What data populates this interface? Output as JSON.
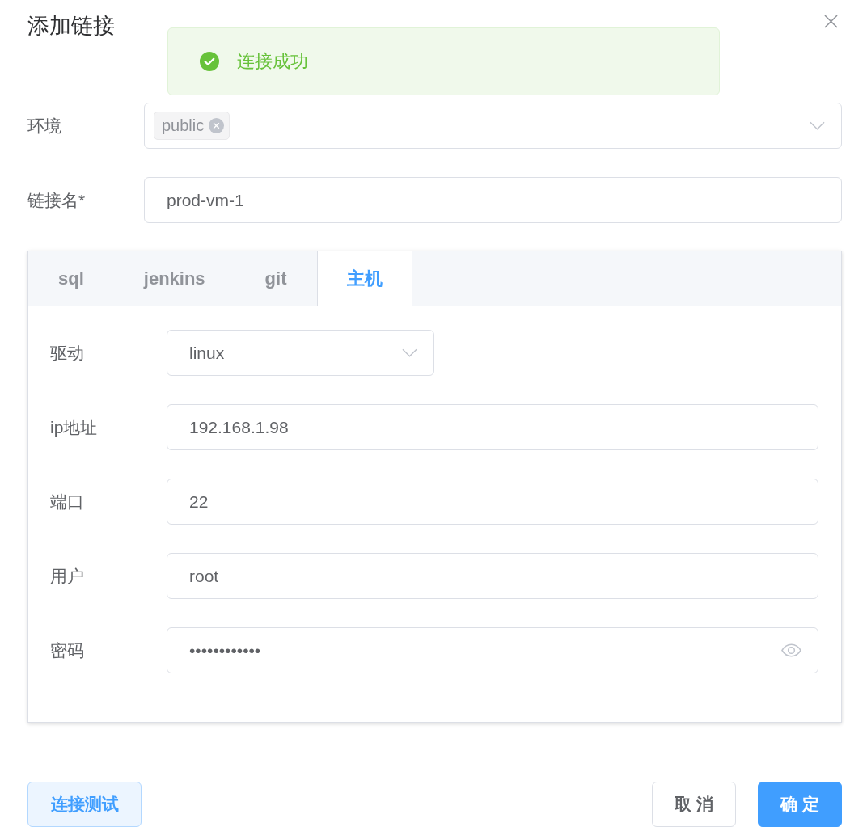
{
  "dialog": {
    "title": "添加链接"
  },
  "message": {
    "kind": "success",
    "text": "连接成功"
  },
  "fields": [
    {
      "label": "环境",
      "kind": "tag-select",
      "tags": [
        {
          "text": "public"
        }
      ]
    },
    {
      "label": "链接名*",
      "kind": "input",
      "value": "prod-vm-1"
    }
  ],
  "tabs": [
    {
      "label": "sql",
      "selected": false
    },
    {
      "label": "jenkins",
      "selected": false
    },
    {
      "label": "git",
      "selected": false
    },
    {
      "label": "主机",
      "selected": true
    }
  ],
  "tab_panel": {
    "fields": [
      {
        "label": "驱动",
        "kind": "select",
        "value": "linux"
      },
      {
        "label": "ip地址",
        "kind": "input",
        "value": "192.168.1.98"
      },
      {
        "label": "端口",
        "kind": "input",
        "value": "22"
      },
      {
        "label": "用户",
        "kind": "input",
        "value": "root"
      },
      {
        "label": "密码",
        "kind": "password",
        "value": "••••••••••••"
      }
    ]
  },
  "footer": {
    "left_buttons": [
      {
        "label": "连接测试",
        "kind": "plain"
      }
    ],
    "right_buttons": [
      {
        "label": "取 消",
        "kind": "default"
      },
      {
        "label": "确 定",
        "kind": "primary"
      }
    ]
  }
}
